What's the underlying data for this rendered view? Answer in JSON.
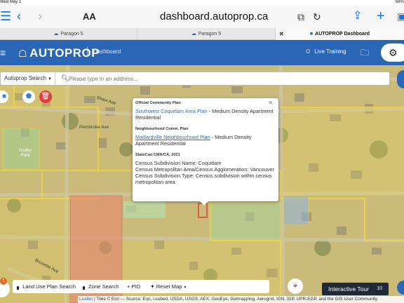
{
  "status": {
    "time": "Wed May 1",
    "battery": "68%"
  },
  "browser": {
    "aa_label": "AA",
    "address": "dashboard.autoprop.ca",
    "tabs": [
      {
        "label": "Paragon 5"
      },
      {
        "label": "Paragon 5"
      },
      {
        "label": "AUTOPROP Dashboard"
      }
    ]
  },
  "app": {
    "logo": "AUTOPROP",
    "section": "Dashboard",
    "live_training": "Live Training"
  },
  "search": {
    "scope": "Autoprop Search",
    "placeholder": "Please type in an address..."
  },
  "popup": {
    "ocp_heading": "Official Community Plan",
    "ocp_link": "Southwest Coquitlam Area Plan",
    "ocp_text": " - Medium Density Apartment Residential",
    "ncp_heading": "Neighbourhood Comm. Plan",
    "ncp_link": "Maillardville Neighbourhood Plan",
    "ncp_text": " - Medium Density Apartment Residential",
    "stats_heading": "StatsCan CMA/CA, 2021",
    "stats_line1": "Census Subdivision Name: Coquitlam",
    "stats_line2": "Census Metropolitan Area/Census Agglomeration: Vancouver",
    "stats_line3": "Census Subdivision Type: Census subdivision within census metropolitan area"
  },
  "map_labels": {
    "shaw_ave": "Shaw Ave",
    "pembroke_ave": "Pembroke Ave",
    "brunette_ave": "Brunette Ave",
    "guilby_park": "Guilby Park"
  },
  "bottom": {
    "land_use": "Land Use Plan Search",
    "zone": "Zone Search",
    "pid": "+ PID",
    "reset": "Reset Map",
    "badge": "1"
  },
  "tour": {
    "label": "Interactive Tour",
    "count": "10"
  },
  "attribution": {
    "leaflet": "Leaflet",
    "text": " | Tiles © Esri — Source: Esri, i-cubed, USDA, USGS, AEX, GeoEye, Getmapping, Aerogrid, IGN, IGP, UPR-EGP, and the GIS User Community"
  },
  "colors": {
    "brand_blue": "#2a66b5",
    "zone_yellow": "#e8d35a",
    "zone_red": "#e8886a",
    "zone_green": "#a8d39a",
    "zone_blue": "#8fb3de"
  }
}
